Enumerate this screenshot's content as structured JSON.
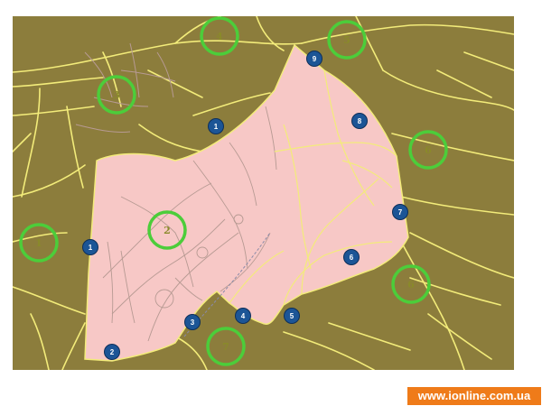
{
  "colors": {
    "terrain": "#8c7d3c",
    "park": "#f7c8c6",
    "road": "#f3ec7a",
    "path": "#b79a93",
    "green_ring": "#4ccd3a",
    "blue_marker": "#1c5596",
    "brand_bg": "#ef7b19"
  },
  "zone_markers": [
    {
      "label": "1"
    },
    {
      "label": "2"
    },
    {
      "label": "3"
    },
    {
      "label": "4"
    },
    {
      "label": "5"
    },
    {
      "label": "6"
    },
    {
      "label": "6"
    },
    {
      "label": "7"
    }
  ],
  "entrance_markers": [
    {
      "label": "1"
    },
    {
      "label": "1"
    },
    {
      "label": "2"
    },
    {
      "label": "3"
    },
    {
      "label": "4"
    },
    {
      "label": "5"
    },
    {
      "label": "6"
    },
    {
      "label": "7"
    },
    {
      "label": "8"
    },
    {
      "label": "9"
    }
  ],
  "brand": {
    "url": "www.ionline.com.ua"
  }
}
